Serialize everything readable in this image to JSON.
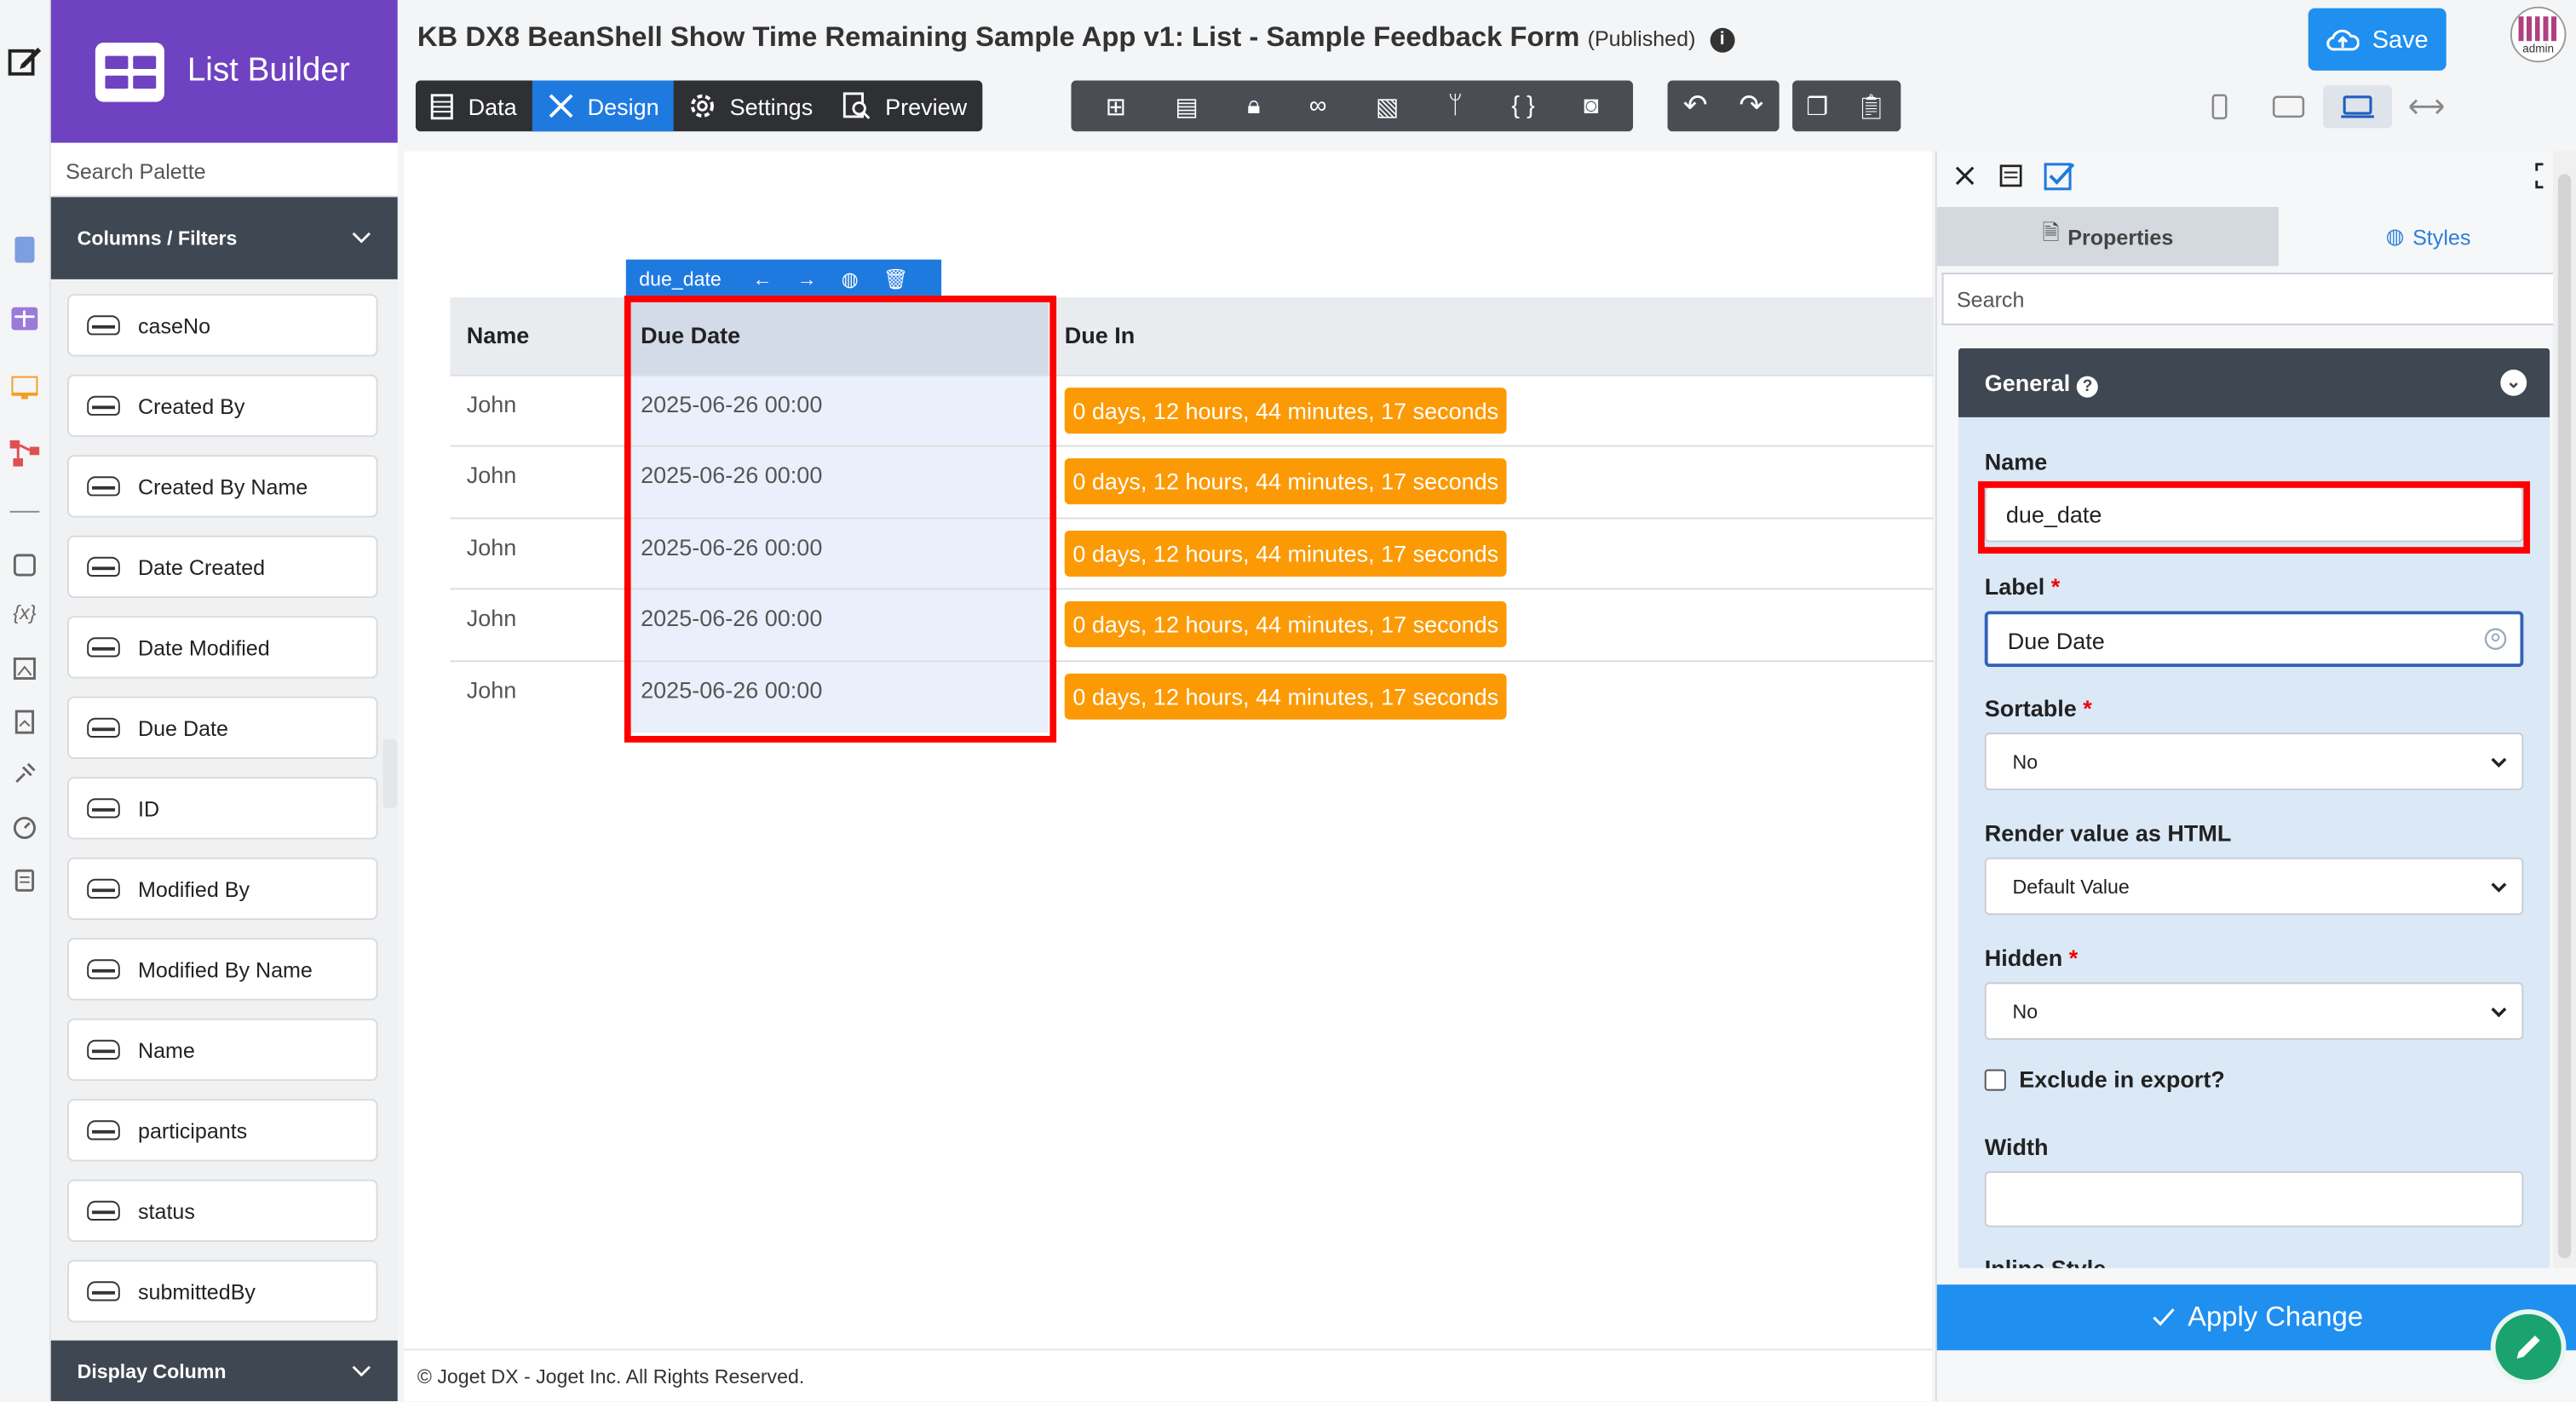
{
  "builder": {
    "title": "List Builder"
  },
  "palette": {
    "search_placeholder": "Search Palette",
    "section_title": "Columns / Filters",
    "items": [
      "caseNo",
      "Created By",
      "Created By Name",
      "Date Created",
      "Date Modified",
      "Due Date",
      "ID",
      "Modified By",
      "Modified By Name",
      "Name",
      "participants",
      "status",
      "submittedBy"
    ],
    "footer_section": "Display Column"
  },
  "header": {
    "app_title": "KB DX8 BeanShell Show Time Remaining Sample App v1: List - Sample Feedback Form",
    "status": "(Published)",
    "save_label": "Save",
    "avatar_text": "admin"
  },
  "tabs": [
    {
      "label": "Data",
      "icon": "table-icon",
      "active": false
    },
    {
      "label": "Design",
      "icon": "design-icon",
      "active": true
    },
    {
      "label": "Settings",
      "icon": "gear-icon",
      "active": false
    },
    {
      "label": "Preview",
      "icon": "preview-icon",
      "active": false
    }
  ],
  "toolbar_icons": [
    "tree-icon",
    "export-icon",
    "lock-icon",
    "binoculars-icon",
    "translate-icon",
    "branch-icon",
    "braces-icon",
    "camera-icon"
  ],
  "list": {
    "selected_column": "due_date",
    "columns": [
      "Name",
      "Due Date",
      "Due In"
    ],
    "rows": [
      {
        "name": "John",
        "due_date": "2025-06-26 00:00",
        "due_in": "0 days, 12 hours, 44 minutes, 17 seconds"
      },
      {
        "name": "John",
        "due_date": "2025-06-26 00:00",
        "due_in": "0 days, 12 hours, 44 minutes, 17 seconds"
      },
      {
        "name": "John",
        "due_date": "2025-06-26 00:00",
        "due_in": "0 days, 12 hours, 44 minutes, 17 seconds"
      },
      {
        "name": "John",
        "due_date": "2025-06-26 00:00",
        "due_in": "0 days, 12 hours, 44 minutes, 17 seconds"
      },
      {
        "name": "John",
        "due_date": "2025-06-26 00:00",
        "due_in": "0 days, 12 hours, 44 minutes, 17 seconds"
      }
    ]
  },
  "footer": {
    "text": "© Joget DX - Joget Inc. All Rights Reserved."
  },
  "properties": {
    "tab_properties": "Properties",
    "tab_styles": "Styles",
    "search_placeholder": "Search",
    "section": "General",
    "name_label": "Name",
    "name_value": "due_date",
    "label_label": "Label",
    "label_value": "Due Date",
    "sortable_label": "Sortable",
    "sortable_value": "No",
    "render_label": "Render value as HTML",
    "render_value": "Default Value",
    "hidden_label": "Hidden",
    "hidden_value": "No",
    "exclude_label": "Exclude in export?",
    "width_label": "Width",
    "width_value": "",
    "inline_style_label": "Inline Style",
    "apply_label": "Apply Change"
  },
  "colors": {
    "brand": "#6f42c1",
    "accent": "#1f7ae0",
    "badge": "#fb9a05",
    "highlight": "#ff0000"
  }
}
